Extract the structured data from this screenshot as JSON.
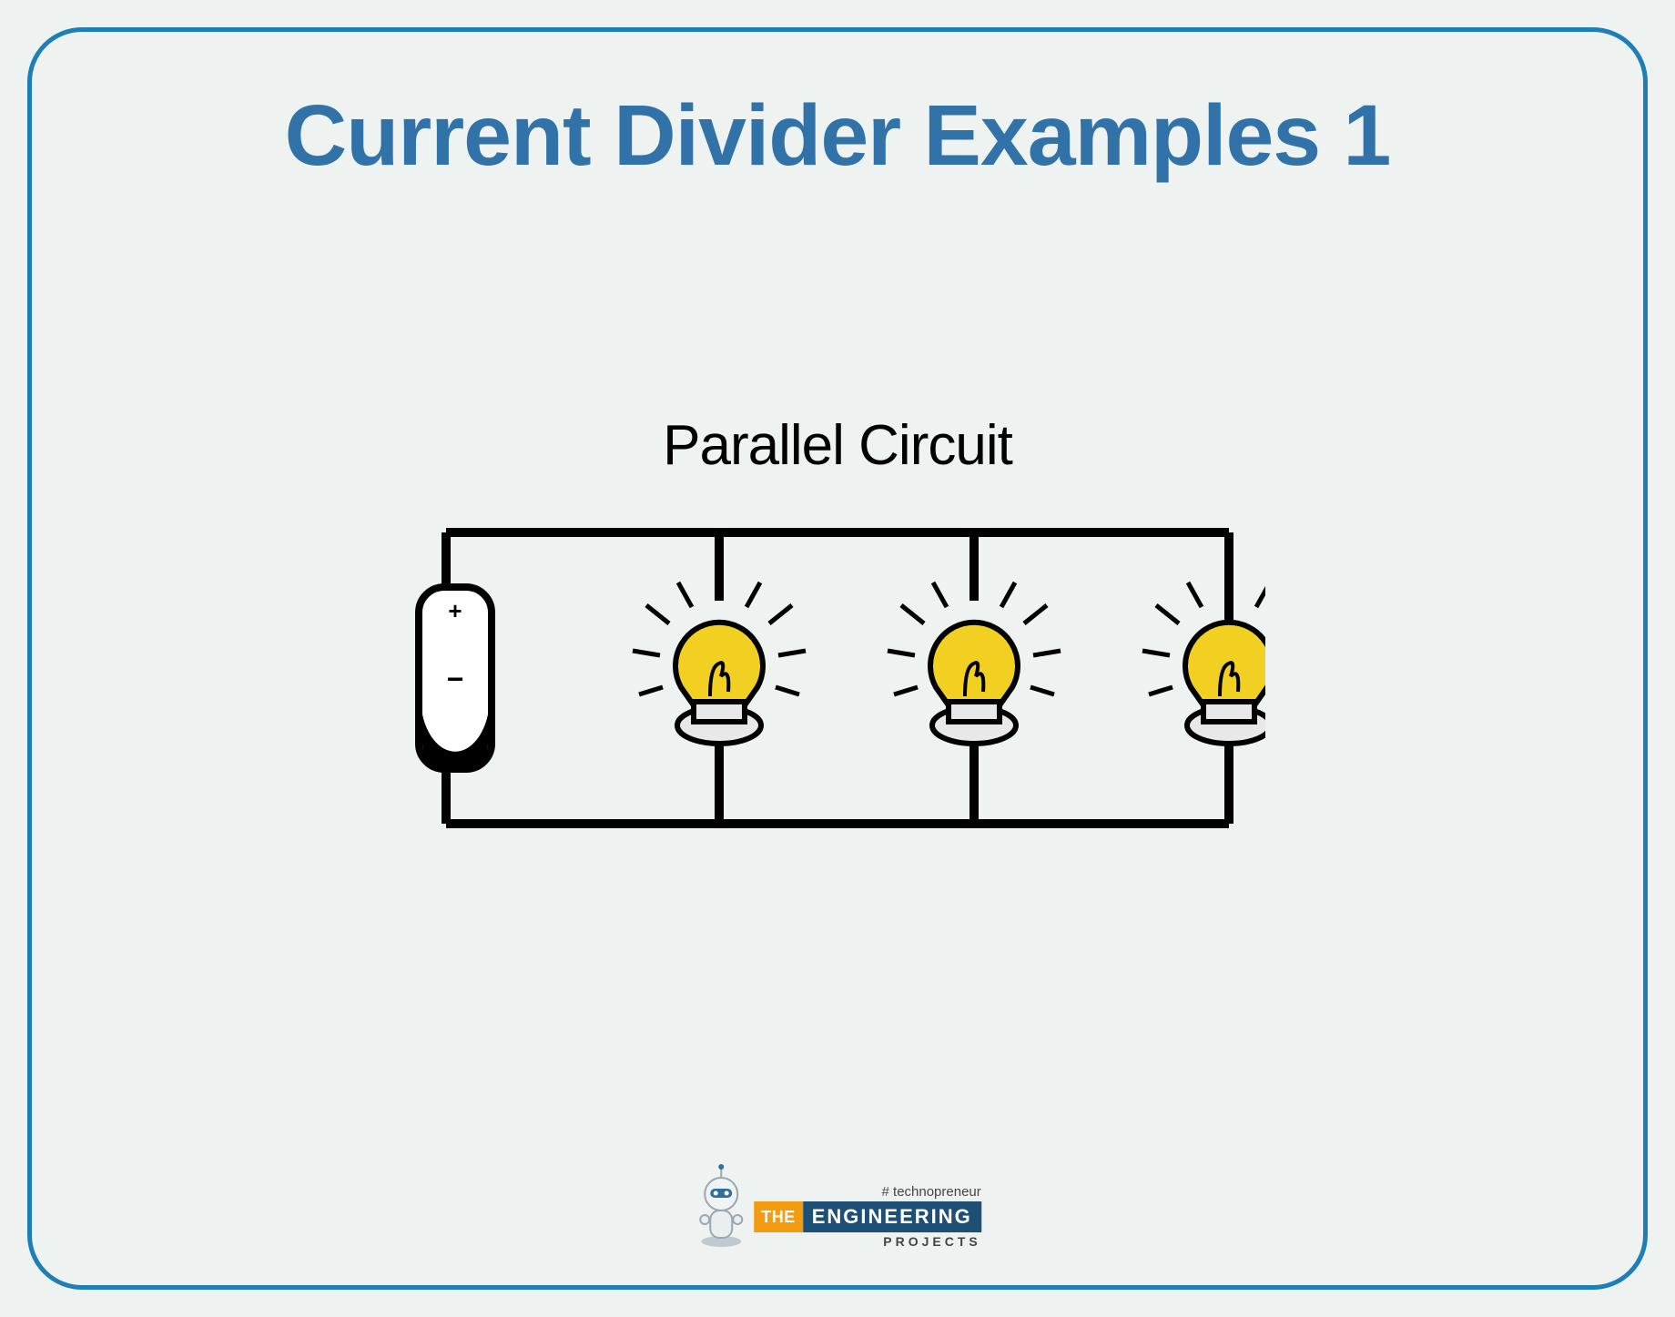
{
  "title": "Current Divider Examples 1",
  "diagram": {
    "label": "Parallel Circuit",
    "source": {
      "type": "battery",
      "polarity": [
        "+",
        "−"
      ]
    },
    "loads": [
      {
        "type": "bulb",
        "state": "lit"
      },
      {
        "type": "bulb",
        "state": "lit"
      },
      {
        "type": "bulb",
        "state": "lit"
      }
    ],
    "topology": "parallel"
  },
  "brand": {
    "tagline": "# technopreneur",
    "word1": "THE",
    "word2": "ENGINEERING",
    "word3": "PROJECTS"
  },
  "colors": {
    "border": "#1e7fb8",
    "title": "#3173a8",
    "bulb": "#f2d021",
    "brand_orange": "#f39c12",
    "brand_blue": "#1e4f74"
  }
}
